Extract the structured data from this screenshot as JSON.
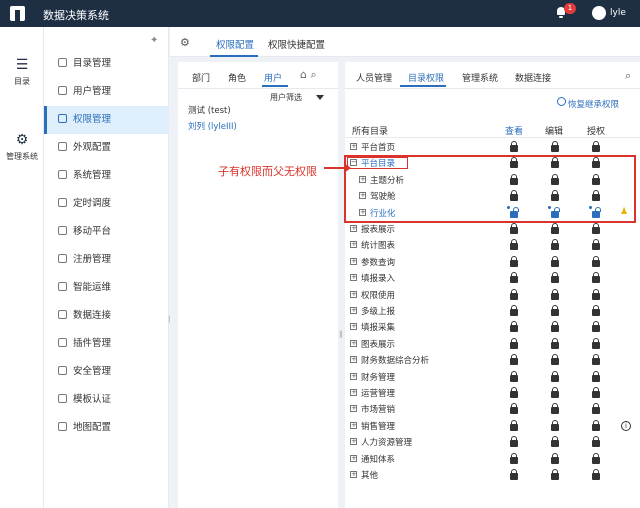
{
  "app": {
    "title": "数据决策系统",
    "badge": "1",
    "user": "lyle"
  },
  "rail": {
    "directory": "目录",
    "admin": "管理系统"
  },
  "sidebar": {
    "items": [
      "目录管理",
      "用户管理",
      "权限管理",
      "外观配置",
      "系统管理",
      "定时调度",
      "移动平台",
      "注册管理",
      "智能运维",
      "数据连接",
      "插件管理",
      "安全管理",
      "模板认证",
      "地图配置"
    ],
    "active_index": 2
  },
  "tabs": {
    "perm_config": "权限配置",
    "perm_quick": "权限快捷配置"
  },
  "left": {
    "tabs": [
      "部门",
      "角色",
      "用户"
    ],
    "filter": "用户筛选",
    "users": [
      "测试 (test)",
      "刘列 (lyleIII)"
    ]
  },
  "right": {
    "tabs": [
      "人员管理",
      "目录权限",
      "管理系统",
      "数据连接"
    ],
    "restore": "恢复继承权限",
    "col_all": "所有目录",
    "col_view": "查看",
    "col_edit": "编辑",
    "col_auth": "授权",
    "rows": [
      "平台首页",
      "平台目录",
      "主题分析",
      "驾驶舱",
      "行业化",
      "报表展示",
      "统计图表",
      "参数查询",
      "填报录入",
      "权限使用",
      "多级上报",
      "填报采集",
      "图表展示",
      "财务数据综合分析",
      "财务管理",
      "运营管理",
      "市场营销",
      "销售管理",
      "人力资源管理",
      "通知体系",
      "其他"
    ]
  },
  "annotation": "子有权限而父无权限",
  "colors": {
    "accent": "#2a6ebc",
    "topbar": "#1e2f44",
    "highlight": "#d9332b"
  }
}
